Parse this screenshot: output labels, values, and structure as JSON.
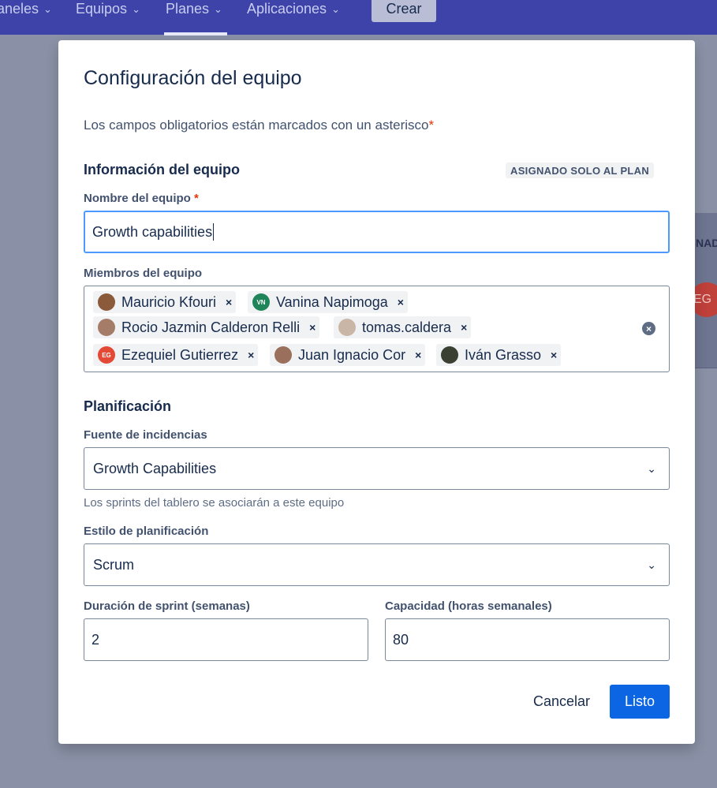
{
  "topnav": {
    "items": [
      {
        "label": "aneles",
        "chevron": "chevron-down-icon"
      },
      {
        "label": "Equipos",
        "chevron": "chevron-down-icon"
      },
      {
        "label": "Planes",
        "chevron": "chevron-down-icon",
        "active": true
      },
      {
        "label": "Aplicaciones",
        "chevron": "chevron-down-icon"
      }
    ],
    "create_label": "Crear"
  },
  "background": {
    "column_label": "NAD",
    "avatar_initials": "EG"
  },
  "modal": {
    "title": "Configuración del equipo",
    "required_note": "Los campos obligatorios están marcados con un asterisco",
    "asterisk": "*",
    "team_info": {
      "section_title": "Información del equipo",
      "scope_badge": "ASIGNADO SOLO AL PLAN",
      "name_label": "Nombre del equipo",
      "name_value": "Growth capabilities",
      "members_label": "Miembros del equipo",
      "members": [
        {
          "name": "Mauricio Kfouri",
          "avatar": "photo",
          "color": "#8a5a3b"
        },
        {
          "name": "Vanina Napimoga",
          "avatar": "VN",
          "color": "#1f845a"
        },
        {
          "name": "Rocio Jazmin Calderon Relli",
          "avatar": "photo",
          "color": "#a57c67"
        },
        {
          "name": "tomas.caldera",
          "avatar": "photo",
          "color": "#c9b6a6"
        },
        {
          "name": "Ezequiel Gutierrez",
          "avatar": "EG",
          "color": "#e34935"
        },
        {
          "name": "Juan Ignacio Cor",
          "avatar": "photo",
          "color": "#9a6f5c"
        },
        {
          "name": "Iván Grasso",
          "avatar": "photo",
          "color": "#3a4032"
        }
      ],
      "remove_symbol": "×",
      "clear_symbol": "×"
    },
    "planning": {
      "section_title": "Planificación",
      "source_label": "Fuente de incidencias",
      "source_value": "Growth Capabilities",
      "source_helper": "Los sprints del tablero se asociarán a este equipo",
      "style_label": "Estilo de planificación",
      "style_value": "Scrum",
      "sprint_label": "Duración de sprint (semanas)",
      "sprint_value": "2",
      "capacity_label": "Capacidad (horas semanales)",
      "capacity_value": "80"
    },
    "actions": {
      "cancel_label": "Cancelar",
      "done_label": "Listo"
    }
  }
}
